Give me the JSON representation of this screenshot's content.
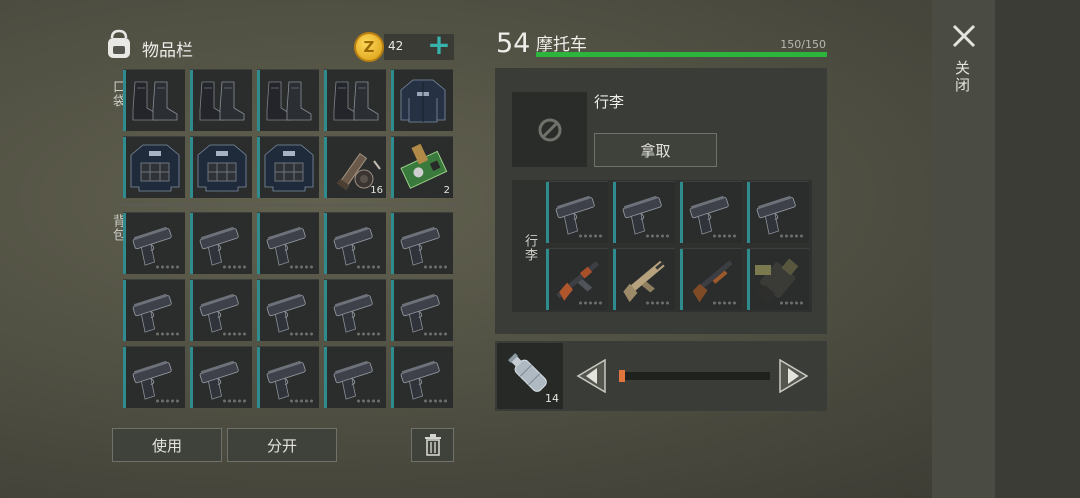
{
  "inventory": {
    "title": "物品栏",
    "coins": "42",
    "add_icon": "plus-icon",
    "pocket_label": "口袋",
    "backpack_label": "背包",
    "pocket_slots": [
      {
        "icon": "boots",
        "qty": ""
      },
      {
        "icon": "boots",
        "qty": ""
      },
      {
        "icon": "boots",
        "qty": ""
      },
      {
        "icon": "boots",
        "qty": ""
      },
      {
        "icon": "jacket",
        "qty": ""
      },
      {
        "icon": "vest",
        "qty": ""
      },
      {
        "icon": "vest",
        "qty": ""
      },
      {
        "icon": "vest",
        "qty": ""
      },
      {
        "icon": "scope",
        "qty": "16"
      },
      {
        "icon": "circuit-board",
        "qty": "2"
      }
    ],
    "backpack_slots": [
      "pistol",
      "pistol",
      "pistol",
      "pistol",
      "pistol",
      "pistol",
      "pistol",
      "pistol",
      "pistol",
      "pistol",
      "pistol",
      "pistol",
      "pistol",
      "pistol",
      "pistol"
    ],
    "use_label": "使用",
    "split_label": "分开"
  },
  "vehicle": {
    "level": "54",
    "name": "摩托车",
    "durability": "150/150",
    "durability_fraction": 1.0,
    "luggage_title": "行李",
    "take_label": "拿取",
    "luggage_side": "行李",
    "slots": [
      "pistol",
      "pistol",
      "pistol",
      "pistol",
      "ak-rifle",
      "scar-rifle",
      "shotgun",
      "grenade-launcher"
    ],
    "fuel_qty": "14",
    "fuel_fraction": 0.0
  },
  "close_label": "关闭",
  "colors": {
    "accent": "#2f8c8e",
    "health": "#2bb53c",
    "coin": "#e8b321"
  }
}
